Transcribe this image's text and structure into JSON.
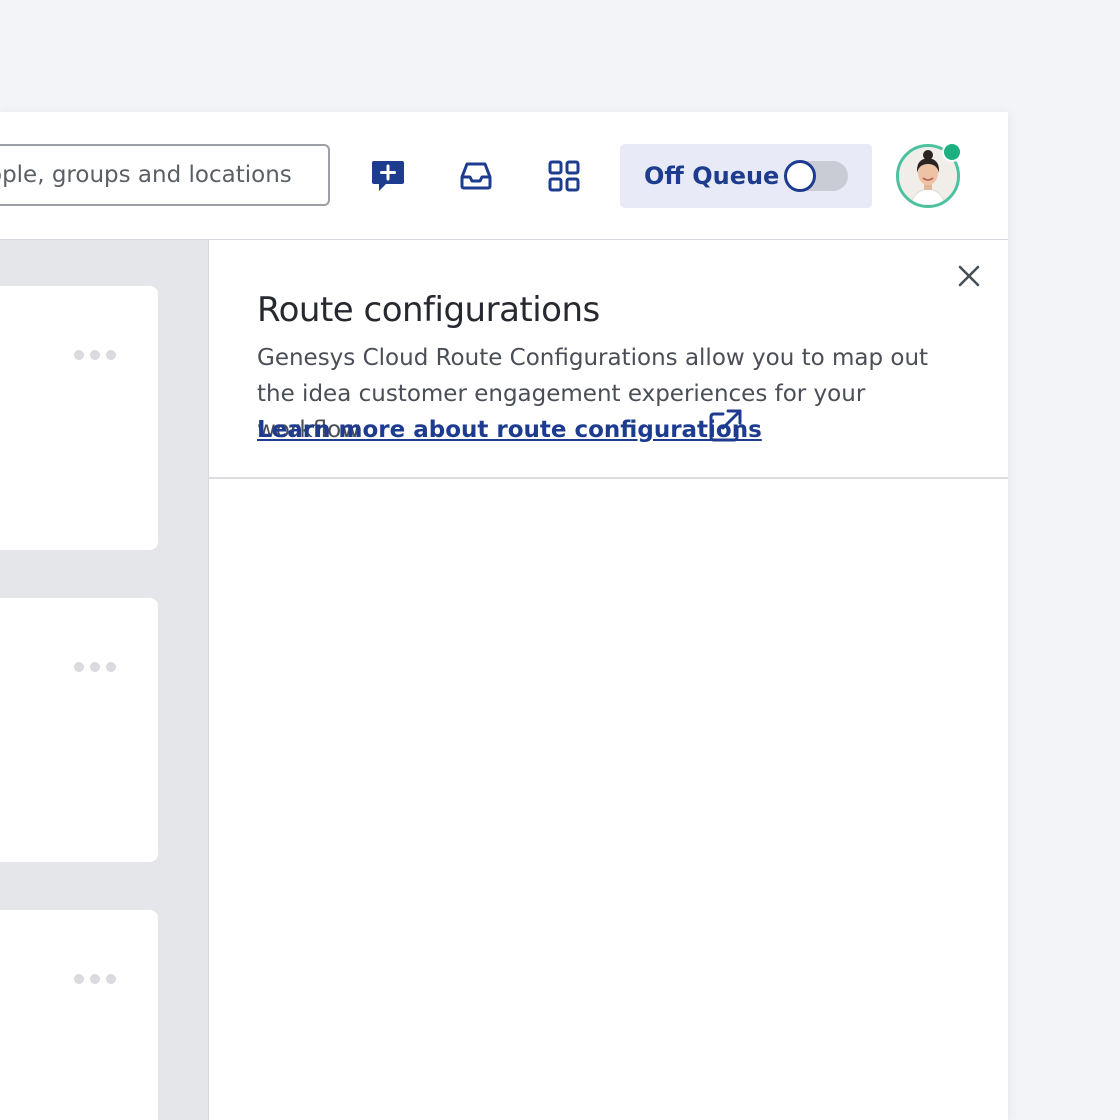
{
  "search": {
    "placeholder": "Search people, groups and locations",
    "visible_text": "ople, groups and locations"
  },
  "toolbar": {
    "icons": [
      "new-chat-icon",
      "inbox-icon",
      "apps-grid-icon"
    ],
    "queue_label": "Off Queue",
    "queue_on": false,
    "presence_status_color": "#1ab07f"
  },
  "cards": [
    {
      "menu_icon": "more-horizontal-icon"
    },
    {
      "menu_icon": "more-horizontal-icon"
    },
    {
      "menu_icon": "more-horizontal-icon"
    }
  ],
  "panel": {
    "title": "Route configurations",
    "description": "Genesys Cloud Route Configurations allow you to map out the idea customer engagement experiences for your workflow",
    "link_label": "Learn more about route configurations",
    "link_icon": "external-link-icon",
    "close_icon": "close-icon"
  },
  "colors": {
    "accent": "#1e3c8f",
    "background": "#f3f4f8",
    "queue_bg": "#e8ebf7",
    "avatar_ring": "#4cc1a0"
  }
}
